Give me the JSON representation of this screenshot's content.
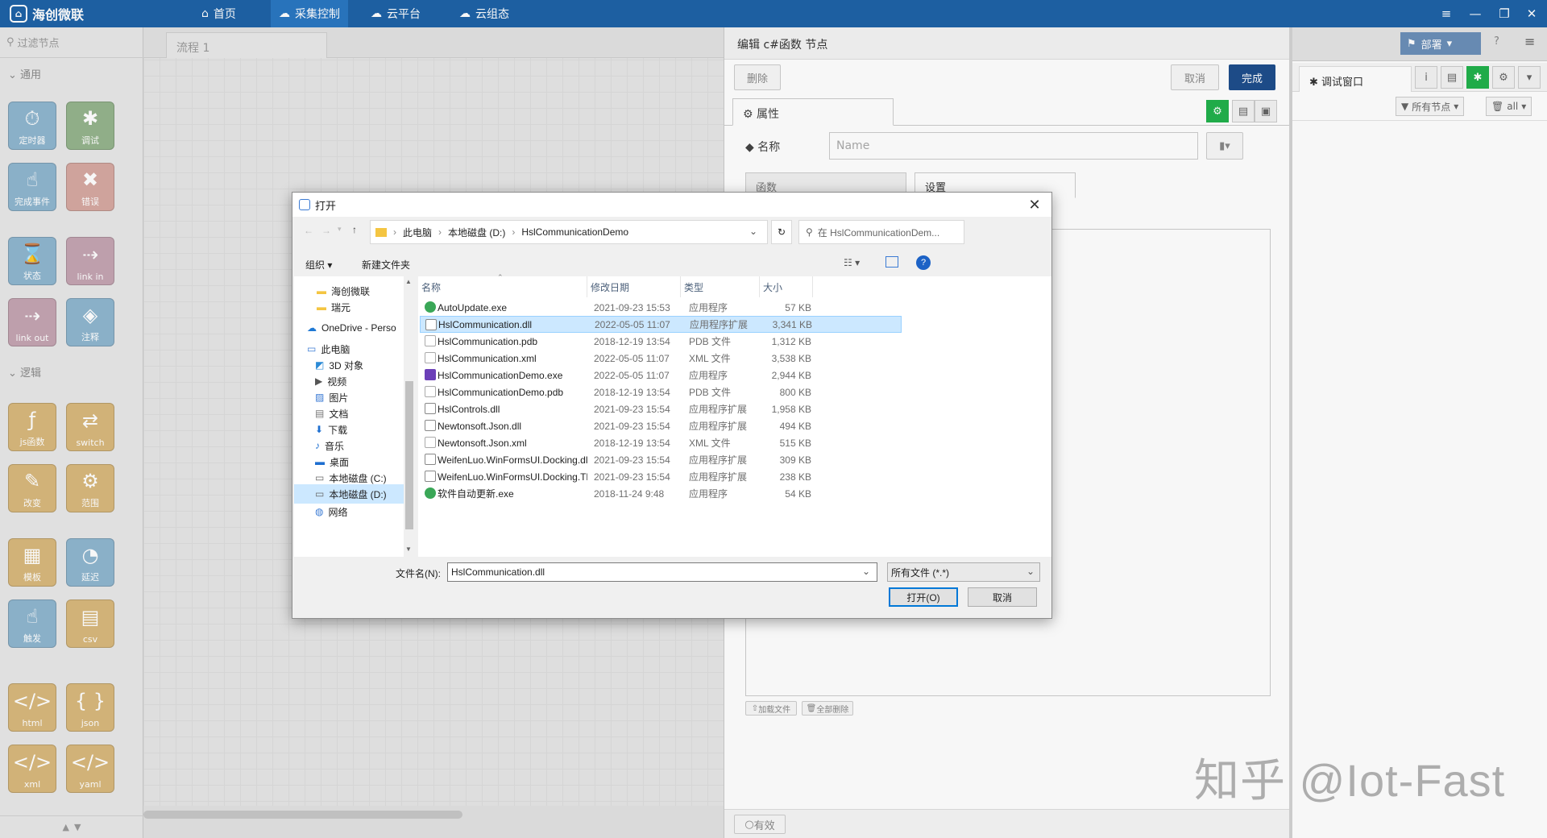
{
  "app": {
    "logo_text": "海创微联"
  },
  "nav": [
    {
      "label": "首页",
      "icon": "home-icon"
    },
    {
      "label": "采集控制",
      "icon": "collect-icon",
      "active": true
    },
    {
      "label": "云平台",
      "icon": "cloud-icon"
    },
    {
      "label": "云组态",
      "icon": "cloud-config-icon"
    }
  ],
  "palette": {
    "filter_placeholder": "过滤节点",
    "categories": {
      "common": "通用",
      "logic": "逻辑"
    },
    "nodes": [
      {
        "label": "定时器",
        "glyph": "⏱",
        "color": "lb"
      },
      {
        "label": "调试",
        "glyph": "✱",
        "color": "gr"
      },
      {
        "label": "完成事件",
        "glyph": "☝",
        "color": "lb"
      },
      {
        "label": "错误",
        "glyph": "✖",
        "color": "cr"
      },
      {
        "label": "状态",
        "glyph": "⌛",
        "color": "lb"
      },
      {
        "label": "link in",
        "glyph": "⇢",
        "color": "pk"
      },
      {
        "label": "link out",
        "glyph": "⇢",
        "color": "pk"
      },
      {
        "label": "注释",
        "glyph": "◈",
        "color": "lb"
      },
      {
        "label": "js函数",
        "glyph": "ƒ",
        "color": "or"
      },
      {
        "label": "switch",
        "glyph": "⇄",
        "color": "or"
      },
      {
        "label": "改变",
        "glyph": "✎",
        "color": "or"
      },
      {
        "label": "范围",
        "glyph": "⚙",
        "color": "or"
      },
      {
        "label": "模板",
        "glyph": "▦",
        "color": "or"
      },
      {
        "label": "延迟",
        "glyph": "◔",
        "color": "lb"
      },
      {
        "label": "触发",
        "glyph": "☝",
        "color": "lb"
      },
      {
        "label": "csv",
        "glyph": "▤",
        "color": "or"
      },
      {
        "label": "html",
        "glyph": "</>",
        "color": "or"
      },
      {
        "label": "json",
        "glyph": "{ }",
        "color": "or"
      },
      {
        "label": "xml",
        "glyph": "</>",
        "color": "or"
      },
      {
        "label": "yaml",
        "glyph": "</>",
        "color": "or"
      }
    ]
  },
  "workspace": {
    "tab_label": "流程 1"
  },
  "editor": {
    "title": "编辑 c#函数 节点",
    "delete_label": "删除",
    "cancel_label": "取消",
    "done_label": "完成",
    "props_tab": "属性",
    "name_label": "名称",
    "name_placeholder": "Name",
    "subtabs": [
      "函数",
      "设置"
    ],
    "load_file_label": "加载文件",
    "delete_all_label": "全部删除",
    "footer_label": "有效"
  },
  "sidebar": {
    "deploy_label": "部署",
    "debug_tab": "调试窗口",
    "filter_nodes": "所有节点",
    "filter_all": "all"
  },
  "watermark": "知乎 @Iot-Fast",
  "dialog": {
    "title": "打开",
    "path": [
      "此电脑",
      "本地磁盘 (D:)",
      "HslCommunicationDemo"
    ],
    "search_placeholder": "在 HslCommunicationDem...",
    "organize_label": "组织 ▾",
    "new_folder_label": "新建文件夹",
    "tree": [
      {
        "label": "海创微联",
        "icon": "folder"
      },
      {
        "label": "瑞元",
        "icon": "folder"
      },
      {
        "label": "OneDrive - Perso",
        "icon": "cloud"
      },
      {
        "label": "此电脑",
        "icon": "pc"
      },
      {
        "label": "3D 对象",
        "icon": "cube"
      },
      {
        "label": "视频",
        "icon": "video"
      },
      {
        "label": "图片",
        "icon": "picture"
      },
      {
        "label": "文档",
        "icon": "doc"
      },
      {
        "label": "下载",
        "icon": "download"
      },
      {
        "label": "音乐",
        "icon": "music"
      },
      {
        "label": "桌面",
        "icon": "desktop"
      },
      {
        "label": "本地磁盘 (C:)",
        "icon": "drive"
      },
      {
        "label": "本地磁盘 (D:)",
        "icon": "drive",
        "selected": true
      },
      {
        "label": "网络",
        "icon": "network"
      }
    ],
    "columns": [
      "名称",
      "修改日期",
      "类型",
      "大小"
    ],
    "files": [
      {
        "name": "AutoUpdate.exe",
        "date": "2021-09-23 15:53",
        "type": "应用程序",
        "size": "57 KB",
        "icon": "exe-green"
      },
      {
        "name": "HslCommunication.dll",
        "date": "2022-05-05 11:07",
        "type": "应用程序扩展",
        "size": "3,341 KB",
        "icon": "dll",
        "selected": true
      },
      {
        "name": "HslCommunication.pdb",
        "date": "2018-12-19 13:54",
        "type": "PDB 文件",
        "size": "1,312 KB",
        "icon": "file"
      },
      {
        "name": "HslCommunication.xml",
        "date": "2022-05-05 11:07",
        "type": "XML 文件",
        "size": "3,538 KB",
        "icon": "file"
      },
      {
        "name": "HslCommunicationDemo.exe",
        "date": "2022-05-05 11:07",
        "type": "应用程序",
        "size": "2,944 KB",
        "icon": "exe-purple"
      },
      {
        "name": "HslCommunicationDemo.pdb",
        "date": "2018-12-19 13:54",
        "type": "PDB 文件",
        "size": "800 KB",
        "icon": "file"
      },
      {
        "name": "HslControls.dll",
        "date": "2021-09-23 15:54",
        "type": "应用程序扩展",
        "size": "1,958 KB",
        "icon": "dll"
      },
      {
        "name": "Newtonsoft.Json.dll",
        "date": "2021-09-23 15:54",
        "type": "应用程序扩展",
        "size": "494 KB",
        "icon": "dll"
      },
      {
        "name": "Newtonsoft.Json.xml",
        "date": "2018-12-19 13:54",
        "type": "XML 文件",
        "size": "515 KB",
        "icon": "file"
      },
      {
        "name": "WeifenLuo.WinFormsUI.Docking.dll",
        "date": "2021-09-23 15:54",
        "type": "应用程序扩展",
        "size": "309 KB",
        "icon": "dll"
      },
      {
        "name": "WeifenLuo.WinFormsUI.Docking.The...",
        "date": "2021-09-23 15:54",
        "type": "应用程序扩展",
        "size": "238 KB",
        "icon": "dll"
      },
      {
        "name": "软件自动更新.exe",
        "date": "2018-11-24 9:48",
        "type": "应用程序",
        "size": "54 KB",
        "icon": "exe-green"
      }
    ],
    "filename_label": "文件名(N):",
    "filename_value": "HslCommunication.dll",
    "filetype_value": "所有文件 (*.*)",
    "open_label": "打开(O)",
    "cancel_label": "取消"
  },
  "colors": {
    "topbar": "#1e63a7",
    "selection": "#cce8ff",
    "primary": "#1e4e8c",
    "green_btn": "#22b14c"
  }
}
